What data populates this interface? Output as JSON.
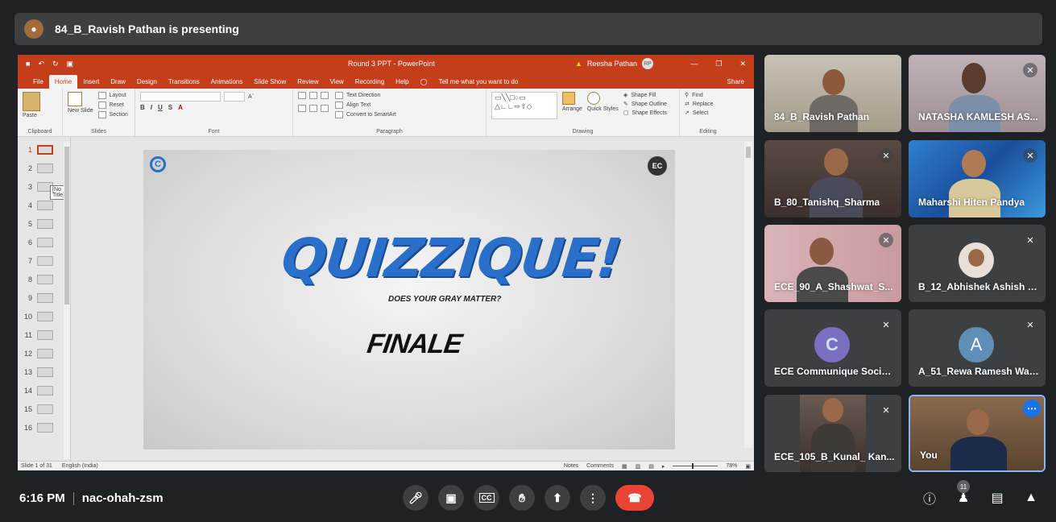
{
  "banner": {
    "text": "84_B_Ravish Pathan is presenting"
  },
  "ppt": {
    "doc_title": "Round 3 PPT - PowerPoint",
    "user": "Reesha Pathan",
    "user_initials": "RP",
    "tabs": [
      "File",
      "Home",
      "Insert",
      "Draw",
      "Design",
      "Transitions",
      "Animations",
      "Slide Show",
      "Review",
      "View",
      "Recording",
      "Help"
    ],
    "tell_me": "Tell me what you want to do",
    "share": "Share",
    "ribbon": {
      "clipboard": {
        "label": "Clipboard",
        "paste": "Paste"
      },
      "slides": {
        "label": "Slides",
        "new_slide": "New Slide",
        "layout": "Layout",
        "reset": "Reset",
        "section": "Section"
      },
      "font": {
        "label": "Font"
      },
      "paragraph": {
        "label": "Paragraph",
        "text_direction": "Text Direction",
        "align_text": "Align Text",
        "convert": "Convert to SmartArt"
      },
      "drawing": {
        "label": "Drawing",
        "arrange": "Arrange",
        "quick_styles": "Quick Styles",
        "shape_fill": "Shape Fill",
        "shape_outline": "Shape Outline",
        "shape_effects": "Shape Effects"
      },
      "editing": {
        "label": "Editing",
        "find": "Find",
        "replace": "Replace",
        "select": "Select"
      }
    },
    "thumbnails": [
      "1",
      "2",
      "3",
      "4",
      "5",
      "6",
      "7",
      "8",
      "9",
      "10",
      "11",
      "12",
      "13",
      "14",
      "15",
      "16"
    ],
    "tooltip": "[No Title]",
    "slide": {
      "title": "QUIZZIQUE!",
      "subtitle": "DOES YOUR GRAY MATTER?",
      "finale": "FINALE"
    },
    "status": {
      "slide_of": "Slide 1 of 31",
      "language": "English (India)",
      "notes": "Notes",
      "comments": "Comments",
      "zoom": "78%"
    }
  },
  "participants": [
    {
      "name": "84_B_Ravish Pathan",
      "muted": false
    },
    {
      "name": "NATASHA KAMLESH AS...",
      "muted": true
    },
    {
      "name": "B_80_Tanishq_Sharma",
      "muted": true
    },
    {
      "name": "Maharshi Hiten Pandya",
      "muted": true
    },
    {
      "name": "ECE_90_A_Shashwat_S...",
      "muted": true
    },
    {
      "name": "B_12_Abhishek Ashish J...",
      "muted": true
    },
    {
      "name": "ECE Communique Society",
      "muted": true
    },
    {
      "name": "A_51_Rewa Ramesh Waz...",
      "muted": true,
      "initial": "A"
    },
    {
      "name": "ECE_105_B_Kunal_ Kan...",
      "muted": true
    },
    {
      "name": "You",
      "muted": false
    }
  ],
  "bottom": {
    "time": "6:16 PM",
    "meeting_code": "nac-ohah-zsm",
    "participant_count": "11"
  },
  "colors": {
    "ppt_accent": "#c43e1c",
    "end_call": "#ea4335",
    "meet_bg": "#202124",
    "avatar_a": "#5f8fb8"
  }
}
